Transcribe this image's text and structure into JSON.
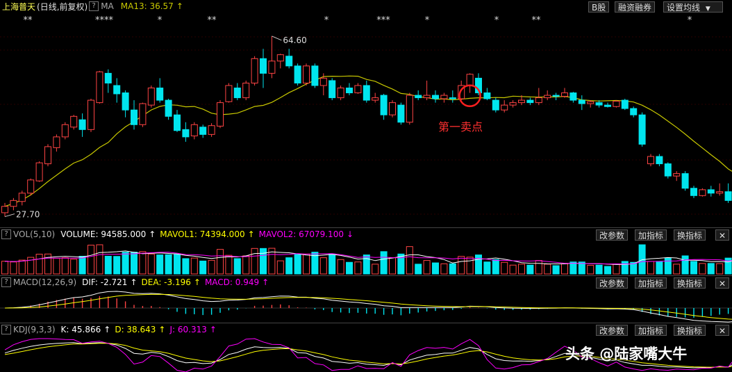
{
  "main": {
    "stock_name": "上海普天",
    "period": "(日线,前复权)",
    "ma_label": "MA",
    "ma13": "MA13: 36.57",
    "ma13_arrow": "↑",
    "buttons": [
      "B股",
      "融资融券",
      "设置均线"
    ],
    "high_label": "64.60",
    "low_label": "27.70",
    "annotation": "第一卖点",
    "markers": [
      "**",
      "****",
      "*",
      "**",
      "*",
      "***",
      "*",
      "*",
      "**",
      "*"
    ]
  },
  "vol": {
    "name": "VOL(5,10)",
    "volume": "VOLUME: 94585.000",
    "volume_arrow": "↑",
    "mavol1": "MAVOL1: 74394.000",
    "mavol1_arrow": "↑",
    "mavol2": "MAVOL2: 67079.100",
    "mavol2_arrow": "↓"
  },
  "macd": {
    "name": "MACD(12,26,9)",
    "dif": "DIF: -2.721",
    "dif_arrow": "↑",
    "dea": "DEA: -3.196",
    "dea_arrow": "↑",
    "macd": "MACD: 0.949",
    "macd_arrow": "↑"
  },
  "kdj": {
    "name": "KDJ(9,3,3)",
    "k": "K: 45.866",
    "k_arrow": "↑",
    "d": "D: 38.643",
    "d_arrow": "↑",
    "j": "J: 60.313",
    "j_arrow": "↑"
  },
  "indicator_buttons": [
    "改参数",
    "加指标",
    "换指标"
  ],
  "watermark": "头条 @陆家嘴大牛",
  "colors": {
    "up": "#ff4444",
    "down": "#00e5ee",
    "ma": "#c8c800",
    "white": "#ffffff",
    "magenta": "#ff00ff",
    "yellow": "#ffff00"
  },
  "chart_data": {
    "type": "candlestick",
    "ohlc": [
      [
        28.5,
        30.5,
        27.7,
        29.8
      ],
      [
        29.8,
        31.5,
        29.0,
        31.0
      ],
      [
        30.8,
        33.0,
        30.0,
        32.5
      ],
      [
        32.5,
        35.5,
        32.0,
        35.2
      ],
      [
        35.0,
        39.0,
        34.8,
        38.7
      ],
      [
        38.5,
        42.5,
        38.0,
        42.0
      ],
      [
        41.8,
        44.5,
        41.0,
        44.0
      ],
      [
        44.0,
        47.0,
        43.5,
        46.5
      ],
      [
        46.0,
        48.5,
        45.5,
        48.2
      ],
      [
        47.5,
        48.8,
        44.0,
        45.5
      ],
      [
        45.5,
        51.8,
        45.0,
        51.5
      ],
      [
        51.0,
        57.5,
        50.8,
        57.3
      ],
      [
        57.0,
        57.8,
        53.0,
        55.0
      ],
      [
        54.5,
        56.0,
        51.0,
        52.8
      ],
      [
        53.0,
        53.5,
        48.0,
        49.5
      ],
      [
        49.5,
        51.5,
        45.5,
        46.5
      ],
      [
        46.5,
        51.0,
        46.0,
        50.8
      ],
      [
        50.5,
        54.5,
        50.0,
        54.0
      ],
      [
        54.0,
        56.0,
        51.0,
        51.5
      ],
      [
        51.5,
        51.8,
        47.5,
        48.2
      ],
      [
        48.5,
        49.5,
        45.0,
        45.3
      ],
      [
        45.5,
        47.0,
        43.0,
        44.0
      ],
      [
        44.2,
        47.0,
        43.5,
        46.5
      ],
      [
        46.0,
        46.5,
        43.8,
        44.5
      ],
      [
        44.5,
        46.8,
        44.0,
        46.3
      ],
      [
        46.2,
        51.5,
        45.8,
        51.0
      ],
      [
        51.2,
        55.0,
        51.0,
        54.5
      ],
      [
        54.0,
        55.0,
        51.5,
        52.0
      ],
      [
        52.0,
        55.5,
        51.5,
        55.0
      ],
      [
        55.0,
        60.5,
        54.5,
        60.0
      ],
      [
        60.0,
        62.0,
        54.0,
        57.0
      ],
      [
        57.0,
        64.6,
        56.0,
        59.5
      ],
      [
        59.5,
        61.0,
        58.0,
        60.8
      ],
      [
        60.5,
        62.0,
        58.0,
        58.5
      ],
      [
        58.5,
        59.0,
        54.5,
        55.0
      ],
      [
        55.0,
        59.0,
        54.5,
        58.5
      ],
      [
        58.5,
        59.0,
        54.0,
        54.5
      ],
      [
        54.5,
        57.0,
        52.5,
        56.0
      ],
      [
        55.5,
        56.0,
        51.5,
        52.0
      ],
      [
        52.0,
        54.5,
        51.5,
        54.0
      ],
      [
        54.0,
        55.0,
        52.5,
        53.0
      ],
      [
        53.0,
        55.0,
        52.8,
        54.5
      ],
      [
        54.5,
        55.5,
        51.0,
        51.5
      ],
      [
        51.5,
        53.0,
        51.0,
        52.0
      ],
      [
        52.5,
        52.8,
        47.5,
        48.5
      ],
      [
        48.5,
        51.5,
        48.0,
        51.0
      ],
      [
        50.5,
        51.0,
        46.5,
        47.0
      ],
      [
        47.0,
        53.0,
        46.5,
        52.5
      ],
      [
        52.5,
        53.5,
        51.5,
        52.0
      ],
      [
        52.0,
        55.5,
        51.5,
        52.5
      ],
      [
        52.5,
        53.5,
        51.0,
        51.8
      ],
      [
        51.8,
        53.0,
        51.0,
        52.5
      ],
      [
        52.0,
        53.5,
        51.0,
        51.8
      ],
      [
        51.8,
        55.5,
        51.5,
        54.5
      ],
      [
        54.5,
        57.0,
        53.0,
        56.8
      ],
      [
        56.0,
        57.0,
        52.5,
        53.0
      ],
      [
        53.0,
        54.0,
        51.5,
        51.8
      ],
      [
        51.5,
        52.0,
        49.0,
        49.5
      ],
      [
        49.5,
        51.5,
        49.0,
        50.5
      ],
      [
        50.5,
        51.5,
        50.0,
        51.0
      ],
      [
        51.0,
        52.5,
        50.5,
        51.5
      ],
      [
        51.5,
        52.0,
        50.5,
        51.0
      ],
      [
        51.0,
        54.0,
        50.5,
        52.0
      ],
      [
        52.0,
        53.5,
        51.5,
        52.5
      ],
      [
        52.5,
        53.0,
        51.5,
        52.3
      ],
      [
        52.3,
        54.0,
        52.0,
        53.0
      ],
      [
        53.0,
        53.2,
        51.0,
        51.5
      ],
      [
        51.5,
        52.5,
        49.5,
        50.8
      ],
      [
        50.8,
        51.5,
        50.0,
        51.2
      ],
      [
        51.0,
        51.5,
        50.0,
        50.5
      ],
      [
        50.5,
        51.0,
        50.0,
        50.2
      ],
      [
        50.2,
        51.5,
        50.0,
        51.3
      ],
      [
        51.5,
        51.8,
        49.5,
        49.8
      ],
      [
        49.8,
        50.2,
        48.0,
        48.5
      ],
      [
        48.5,
        49.0,
        42.0,
        42.5
      ],
      [
        38.5,
        40.5,
        38.0,
        40.0
      ],
      [
        40.0,
        40.5,
        38.0,
        38.5
      ],
      [
        38.5,
        38.8,
        35.5,
        36.0
      ],
      [
        36.0,
        37.0,
        35.0,
        36.5
      ],
      [
        36.5,
        37.0,
        33.0,
        33.5
      ],
      [
        33.5,
        34.0,
        31.5,
        32.0
      ],
      [
        32.0,
        33.5,
        31.8,
        33.2
      ],
      [
        33.2,
        34.0,
        31.8,
        32.5
      ],
      [
        32.5,
        34.5,
        32.0,
        32.8
      ],
      [
        32.8,
        34.5,
        30.5,
        31.0
      ],
      [
        31.0,
        36.0,
        30.5,
        35.5
      ],
      [
        35.5,
        36.0,
        32.5,
        33.0
      ],
      [
        33.0,
        34.5,
        32.5,
        34.2
      ],
      [
        34.2,
        35.0,
        33.5,
        34.6
      ],
      [
        34.6,
        37.0,
        34.0,
        36.5
      ],
      [
        36.5,
        37.0,
        35.5,
        36.0
      ],
      [
        36.0,
        38.5,
        35.8,
        36.3
      ],
      [
        36.3,
        37.2,
        35.8,
        36.8
      ],
      [
        36.8,
        37.5,
        35.5,
        37.0
      ],
      [
        37.0,
        37.5,
        34.0,
        34.5
      ],
      [
        34.5,
        35.0,
        33.5,
        34.2
      ],
      [
        34.2,
        34.5,
        31.5,
        32.0
      ],
      [
        32.0,
        32.5,
        30.5,
        31.0
      ],
      [
        31.0,
        33.0,
        30.5,
        32.6
      ],
      [
        32.6,
        33.0,
        31.8,
        32.0
      ],
      [
        32.0,
        33.0,
        31.5,
        32.8
      ],
      [
        32.8,
        33.2,
        32.0,
        32.3
      ],
      [
        32.0,
        34.0,
        31.5,
        33.8
      ],
      [
        33.8,
        36.0,
        33.5,
        35.0
      ],
      [
        35.0,
        36.5,
        34.5,
        35.7
      ]
    ],
    "high": 64.6,
    "low": 27.7,
    "ma13_last": 36.57,
    "ylim": [
      26.5,
      68.0
    ]
  }
}
